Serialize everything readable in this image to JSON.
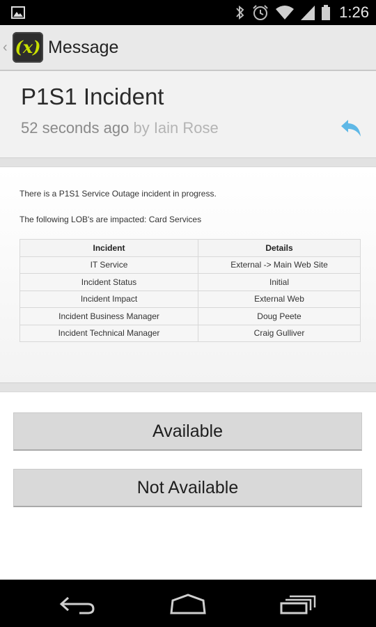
{
  "status_bar": {
    "time": "1:26",
    "icons": [
      "picture-icon",
      "bluetooth-icon",
      "alarm-icon",
      "wifi-icon",
      "signal-icon",
      "battery-icon"
    ]
  },
  "action_bar": {
    "title": "Message",
    "app_icon_text": "(x)"
  },
  "message": {
    "title": "P1S1 Incident",
    "time_ago": "52 seconds ago",
    "by_text": "by Iain Rose",
    "body_line1": "There is a P1S1 Service Outage incident in progress.",
    "body_line2": "The following LOB's are impacted: Card Services",
    "table": {
      "headers": [
        "Incident",
        "Details"
      ],
      "rows": [
        [
          "IT Service",
          "External -> Main Web Site"
        ],
        [
          "Incident Status",
          "Initial"
        ],
        [
          "Incident Impact",
          "External Web"
        ],
        [
          "Incident Business Manager",
          "Doug Peete"
        ],
        [
          "Incident Technical Manager",
          "Craig Gulliver"
        ]
      ]
    }
  },
  "buttons": {
    "available": "Available",
    "not_available": "Not Available"
  },
  "colors": {
    "reply_icon": "#5fb8e6",
    "app_icon_accent": "#c9e000"
  }
}
